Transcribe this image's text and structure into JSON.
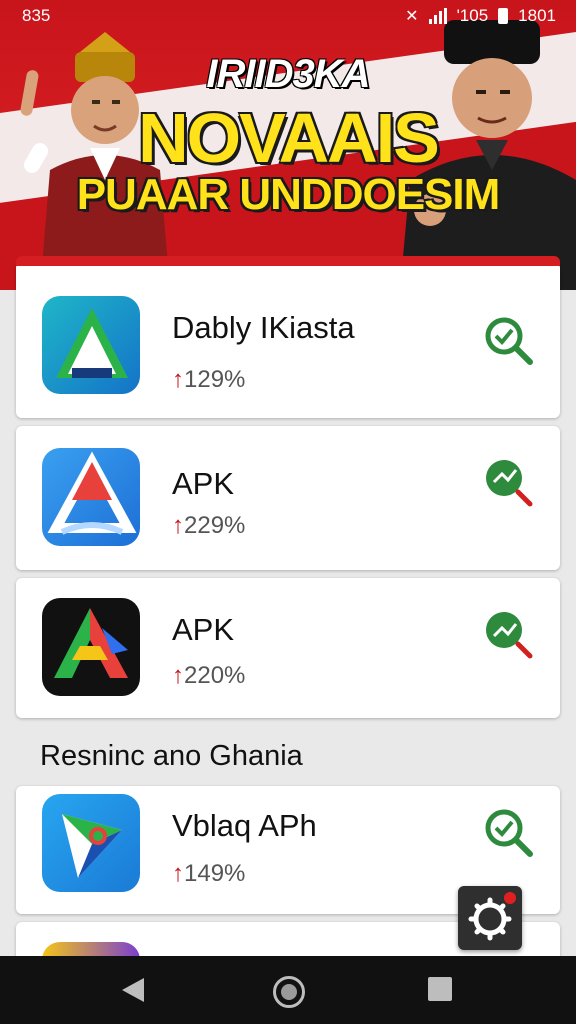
{
  "status_bar": {
    "time": "835",
    "network": "'105",
    "clock": "1801"
  },
  "banner": {
    "line1": "IRIID3KA",
    "line2": "NOVAAIS",
    "line3": "PUAAR UNDDOESIM"
  },
  "apps": [
    {
      "name": "Dably IKiasta",
      "percent": "129%",
      "icon": "app-icon-green-a",
      "action": "magnifier-check-icon"
    },
    {
      "name": "APK",
      "percent": "229%",
      "icon": "app-icon-blue-a",
      "action": "magnifier-arrow-icon"
    },
    {
      "name": "APK",
      "percent": "220%",
      "icon": "app-icon-multicolor-a",
      "action": "magnifier-chart-icon"
    }
  ],
  "section": {
    "title": "Resninc ano Ghania"
  },
  "apps_more": [
    {
      "name": "Vblaq APh",
      "percent": "149%",
      "icon": "app-icon-map-triangle",
      "action": "magnifier-check-icon"
    }
  ],
  "colors": {
    "banner_red": "#d41e22",
    "banner_yellow": "#ffe21a",
    "action_green": "#2e8b3e",
    "accent_red": "#c8141b"
  }
}
